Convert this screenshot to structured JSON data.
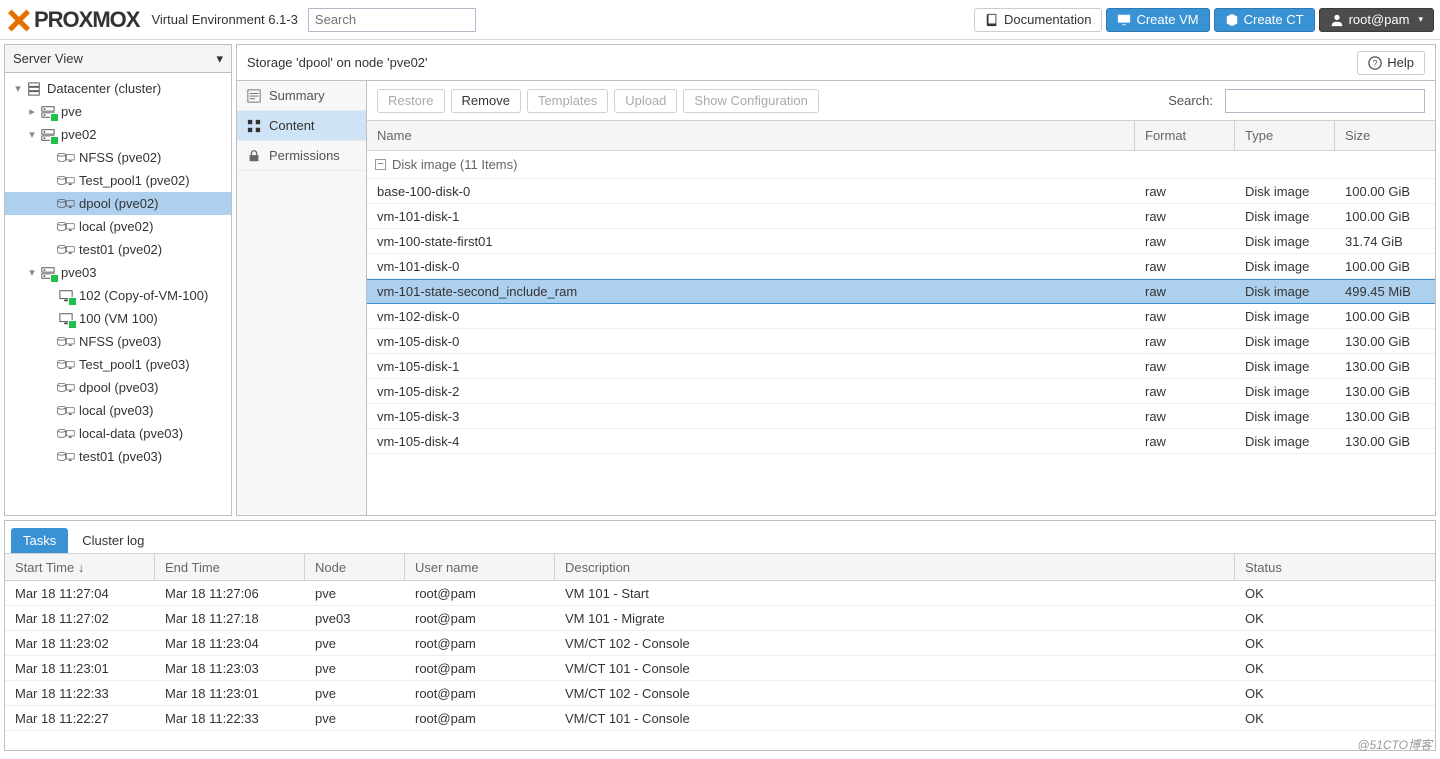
{
  "brand": "PROXMOX",
  "ve_label": "Virtual Environment 6.1-3",
  "search_placeholder": "Search",
  "header_buttons": {
    "docs": "Documentation",
    "create_vm": "Create VM",
    "create_ct": "Create CT",
    "user": "root@pam"
  },
  "server_view_label": "Server View",
  "tree": {
    "root": "Datacenter (cluster)",
    "pve": "pve",
    "pve02": "pve02",
    "pve02_children": [
      "NFSS (pve02)",
      "Test_pool1 (pve02)",
      "dpool (pve02)",
      "local (pve02)",
      "test01 (pve02)"
    ],
    "pve03": "pve03",
    "pve03_children": [
      "102 (Copy-of-VM-100)",
      "100 (VM 100)",
      "NFSS (pve03)",
      "Test_pool1 (pve03)",
      "dpool (pve03)",
      "local (pve03)",
      "local-data (pve03)",
      "test01 (pve03)"
    ]
  },
  "panel_title": "Storage 'dpool' on node 'pve02'",
  "help_label": "Help",
  "side_tabs": {
    "summary": "Summary",
    "content": "Content",
    "permissions": "Permissions"
  },
  "toolbar": {
    "restore": "Restore",
    "remove": "Remove",
    "templates": "Templates",
    "upload": "Upload",
    "show_config": "Show Configuration",
    "search_label": "Search:"
  },
  "grid_headers": {
    "name": "Name",
    "format": "Format",
    "type": "Type",
    "size": "Size"
  },
  "group_label": "Disk image (11 Items)",
  "rows": [
    {
      "name": "base-100-disk-0",
      "format": "raw",
      "type": "Disk image",
      "size": "100.00 GiB"
    },
    {
      "name": "vm-101-disk-1",
      "format": "raw",
      "type": "Disk image",
      "size": "100.00 GiB"
    },
    {
      "name": "vm-100-state-first01",
      "format": "raw",
      "type": "Disk image",
      "size": "31.74 GiB"
    },
    {
      "name": "vm-101-disk-0",
      "format": "raw",
      "type": "Disk image",
      "size": "100.00 GiB"
    },
    {
      "name": "vm-101-state-second_include_ram",
      "format": "raw",
      "type": "Disk image",
      "size": "499.45 MiB"
    },
    {
      "name": "vm-102-disk-0",
      "format": "raw",
      "type": "Disk image",
      "size": "100.00 GiB"
    },
    {
      "name": "vm-105-disk-0",
      "format": "raw",
      "type": "Disk image",
      "size": "130.00 GiB"
    },
    {
      "name": "vm-105-disk-1",
      "format": "raw",
      "type": "Disk image",
      "size": "130.00 GiB"
    },
    {
      "name": "vm-105-disk-2",
      "format": "raw",
      "type": "Disk image",
      "size": "130.00 GiB"
    },
    {
      "name": "vm-105-disk-3",
      "format": "raw",
      "type": "Disk image",
      "size": "130.00 GiB"
    },
    {
      "name": "vm-105-disk-4",
      "format": "raw",
      "type": "Disk image",
      "size": "130.00 GiB"
    }
  ],
  "selected_row": 4,
  "tasks_tabs": {
    "tasks": "Tasks",
    "cluster_log": "Cluster log"
  },
  "task_headers": {
    "start": "Start Time",
    "end": "End Time",
    "node": "Node",
    "user": "User name",
    "desc": "Description",
    "status": "Status"
  },
  "tasks": [
    {
      "start": "Mar 18 11:27:04",
      "end": "Mar 18 11:27:06",
      "node": "pve",
      "user": "root@pam",
      "desc": "VM 101 - Start",
      "status": "OK"
    },
    {
      "start": "Mar 18 11:27:02",
      "end": "Mar 18 11:27:18",
      "node": "pve03",
      "user": "root@pam",
      "desc": "VM 101 - Migrate",
      "status": "OK"
    },
    {
      "start": "Mar 18 11:23:02",
      "end": "Mar 18 11:23:04",
      "node": "pve",
      "user": "root@pam",
      "desc": "VM/CT 102 - Console",
      "status": "OK"
    },
    {
      "start": "Mar 18 11:23:01",
      "end": "Mar 18 11:23:03",
      "node": "pve",
      "user": "root@pam",
      "desc": "VM/CT 101 - Console",
      "status": "OK"
    },
    {
      "start": "Mar 18 11:22:33",
      "end": "Mar 18 11:23:01",
      "node": "pve",
      "user": "root@pam",
      "desc": "VM/CT 102 - Console",
      "status": "OK"
    },
    {
      "start": "Mar 18 11:22:27",
      "end": "Mar 18 11:22:33",
      "node": "pve",
      "user": "root@pam",
      "desc": "VM/CT 101 - Console",
      "status": "OK"
    }
  ],
  "watermark": "@51CTO博客"
}
